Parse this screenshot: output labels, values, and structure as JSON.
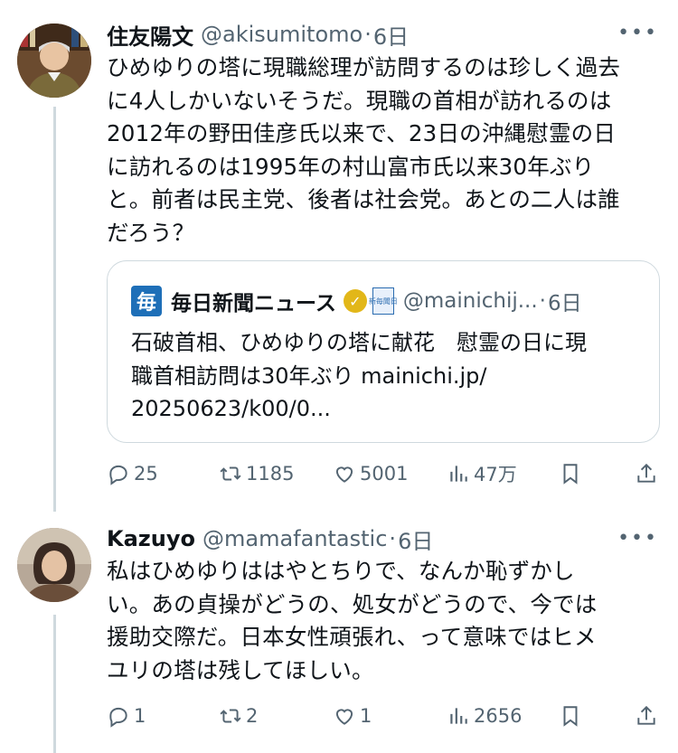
{
  "posts": [
    {
      "author": "住友陽文",
      "handle": "@akisumitomo",
      "time": "6日",
      "text_lines": [
        "ひめゆりの塔に現職総理が訪問するのは珍しく過去",
        "に4人しかいないそうだ。現職の首相が訪れるのは",
        "2012年の野田佳彦氏以来で、23日の沖縄慰霊の日",
        "に訪れるのは1995年の村山富市氏以来30年ぶり",
        "と。前者は民主党、後者は社会党。あとの二人は誰",
        "だろう？"
      ],
      "quote": {
        "logo_char": "毎",
        "name": "毎日新聞ニュース",
        "org_badge": "新毎聞日",
        "handle": "@mainichij...",
        "time": "6日",
        "text_lines": [
          "石破首相、ひめゆりの塔に献花　慰霊の日に現",
          "職首相訪問は30年ぶり mainichi.jp/",
          "20250623/k00/0..."
        ]
      },
      "replies": "25",
      "reposts": "1185",
      "likes": "5001",
      "views": "47万"
    },
    {
      "author": "Kazuyo",
      "handle": "@mamafantastic",
      "time": "6日",
      "text_lines": [
        "私はひめゆりははやとちりで、なんか恥ずかし",
        "い。あの貞操がどうの、処女がどうので、今では",
        "援助交際だ。日本女性頑張れ、って意味ではヒメ",
        "ユリの塔は残してほしい。"
      ],
      "replies": "1",
      "reposts": "2",
      "likes": "1",
      "views": "2656"
    }
  ],
  "icons": {
    "reply": "reply-icon",
    "repost": "repost-icon",
    "like": "heart-icon",
    "views": "views-icon",
    "bookmark": "bookmark-icon",
    "share": "share-icon",
    "more": "more-icon"
  },
  "separator": "·",
  "more_glyph": "•••"
}
